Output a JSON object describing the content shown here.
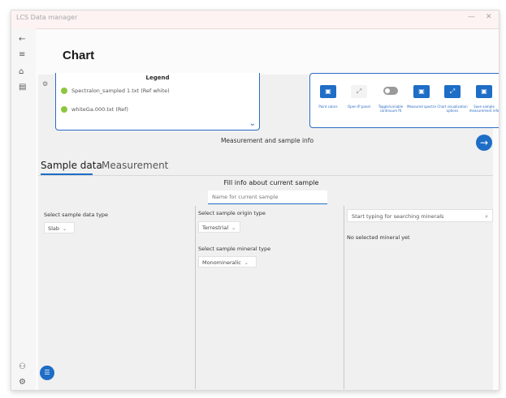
{
  "window": {
    "app_title": "LCS Data manager",
    "minimize": "—",
    "close": "✕"
  },
  "nav": {
    "back": "←",
    "menu": "≡",
    "home": "⌂",
    "chart": "▤",
    "user": "⚇",
    "settings": "⚙",
    "fab": "☰"
  },
  "page_title": "Chart",
  "legend": {
    "title": "Legend",
    "items": [
      "Spectralon_sampled 1.txt (Ref white)",
      "whiteGa.000.txt (Ref)"
    ],
    "item_color": "#8cc63f",
    "chevron": "⌄",
    "side_icon": "⚙"
  },
  "tools": [
    {
      "icon": "▣",
      "label": "Point colors",
      "style": "blue"
    },
    {
      "icon": "⤢",
      "label": "Open IP panel",
      "style": "light"
    },
    {
      "icon": "",
      "label": "Toggle/variable continuum fit",
      "style": "toggle"
    },
    {
      "icon": "▣",
      "label": "Measured spectra",
      "style": "blue"
    },
    {
      "icon": "⤢",
      "label": "Chart visualization options",
      "style": "blue"
    },
    {
      "icon": "▣",
      "label": "Save sample measurement info",
      "style": "blue"
    }
  ],
  "measurement_label": "Measurement and sample info",
  "next_button": "→",
  "tabs": {
    "sample": "Sample data",
    "measurement": "Measurement"
  },
  "fill_title": "Fill info about current sample",
  "name_placeholder": "Name for current sample",
  "sample_data_type": {
    "label": "Select sample data type",
    "value": "Slab"
  },
  "origin_type": {
    "label": "Select sample origin type",
    "value": "Terrestrial"
  },
  "mineral_type": {
    "label": "Select sample mineral type",
    "value": "Monomineralic"
  },
  "mineral_search_placeholder": "Start typing for searching minerals",
  "search_icon": "⌕",
  "no_mineral": "No selected mineral yet",
  "accent_color": "#1e6dc6"
}
